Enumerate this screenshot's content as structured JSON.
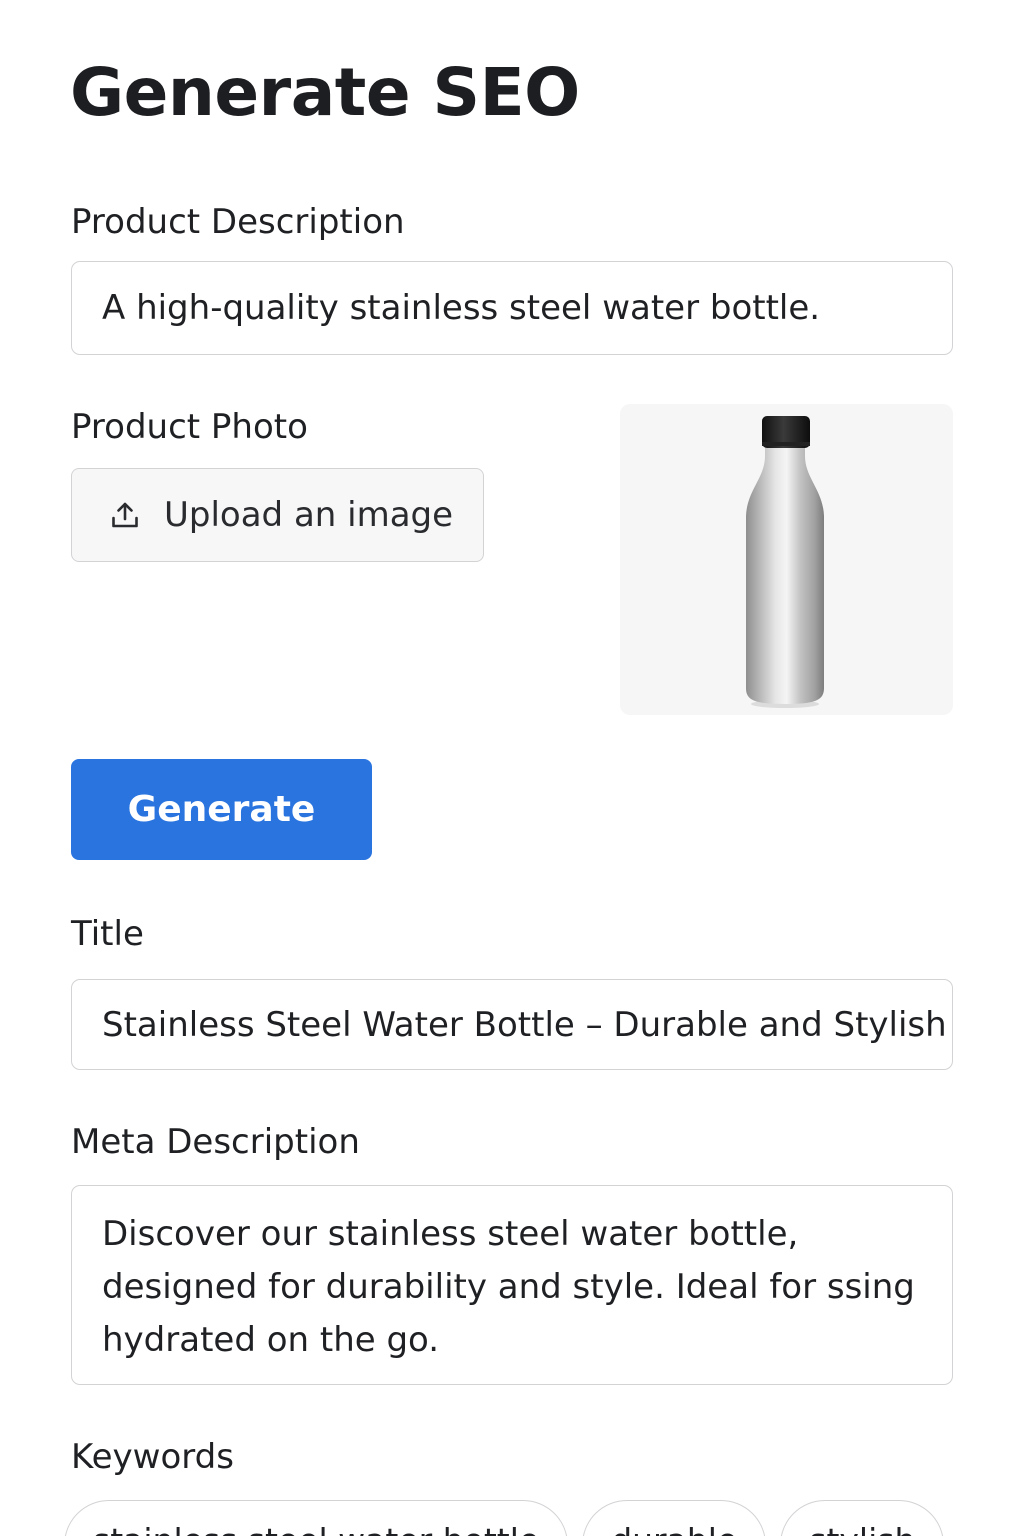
{
  "page": {
    "title": "Generate SEO"
  },
  "product_description": {
    "label": "Product Description",
    "value": "A high-quality stainless steel water bottle."
  },
  "product_photo": {
    "label": "Product Photo",
    "upload_label": "Upload an image",
    "upload_icon": "upload-icon",
    "preview": "stainless steel water bottle photo"
  },
  "generate_button": {
    "label": "Generate",
    "color": "#2a74e0"
  },
  "title_field": {
    "label": "Title",
    "value": "Stainless Steel Water Bottle – Durable and Stylish"
  },
  "meta_description": {
    "label": "Meta Description",
    "value": "Discover our stainless steel water bottle, designed for durability and style. Ideal for ssing hydrated on the go."
  },
  "keywords": {
    "label": "Keywords",
    "items": [
      "stainless steel water bottle",
      "durable",
      "stylish"
    ]
  }
}
